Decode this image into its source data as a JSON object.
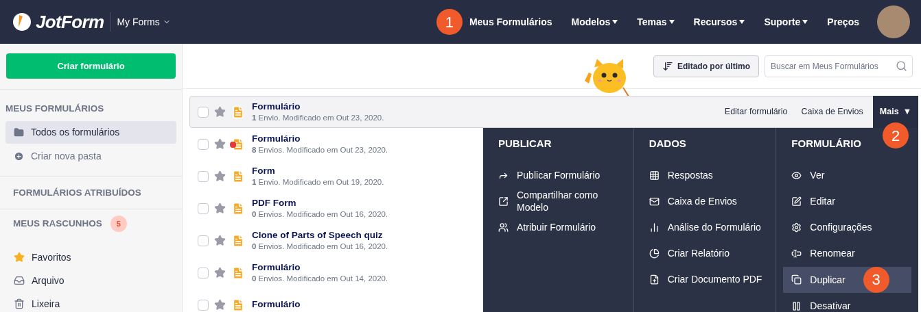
{
  "header": {
    "logo": "JotForm",
    "workspace": "My Forms",
    "nav": [
      {
        "label": "Meus Formulários",
        "has_menu": false,
        "step": "1"
      },
      {
        "label": "Modelos",
        "has_menu": true
      },
      {
        "label": "Temas",
        "has_menu": true
      },
      {
        "label": "Recursos",
        "has_menu": true
      },
      {
        "label": "Suporte",
        "has_menu": true
      },
      {
        "label": "Preços",
        "has_menu": false
      }
    ]
  },
  "sidebar": {
    "create_button": "Criar formulário",
    "my_forms": {
      "title": "MEUS FORMULÁRIOS",
      "items": [
        {
          "label": "Todos os formulários",
          "selected": true
        },
        {
          "label": "Criar nova pasta",
          "selected": false
        }
      ]
    },
    "assigned": {
      "title": "FORMULÁRIOS ATRIBUÍDOS"
    },
    "drafts": {
      "title": "MEUS RASCUNHOS",
      "count": "5"
    },
    "items": [
      {
        "label": "Favoritos",
        "selected": false
      },
      {
        "label": "Arquivo",
        "selected": false
      },
      {
        "label": "Lixeira",
        "selected": false
      }
    ]
  },
  "toolbar": {
    "sort_button": "Editado por último",
    "search": {
      "placeholder": "Buscar em Meus Formulários"
    }
  },
  "forms": [
    {
      "title": "Formulário",
      "count": "1",
      "details": " Envio. Modificado em Out 23, 2020.",
      "selected": true,
      "badge": false
    },
    {
      "title": "Formulário",
      "count": "8",
      "details": " Envios. Modificado em Out 23, 2020.",
      "selected": false,
      "badge": true
    },
    {
      "title": "Form",
      "count": "1",
      "details": " Envio. Modificado em Out 19, 2020.",
      "selected": false,
      "badge": false
    },
    {
      "title": "PDF Form",
      "count": "0",
      "details": " Envios. Modificado em Out 16, 2020.",
      "selected": false,
      "badge": false
    },
    {
      "title": "Clone of Parts of Speech quiz",
      "count": "0",
      "details": " Envios. Modificado em Out 16, 2020.",
      "selected": false,
      "badge": false
    },
    {
      "title": "Formulário",
      "count": "0",
      "details": " Envios. Modificado em Out 14, 2020.",
      "selected": false,
      "badge": false
    },
    {
      "title": "Formulário",
      "selected": false,
      "badge": false
    }
  ],
  "row_actions": {
    "edit": "Editar formulário",
    "inbox": "Caixa de Envios",
    "more": "Mais",
    "more_caret": "▼",
    "step": "2"
  },
  "more_menu": {
    "columns": [
      {
        "title": "PUBLICAR",
        "items": [
          {
            "label": "Publicar Formulário",
            "selected": false
          },
          {
            "label": "Compartilhar como Modelo",
            "selected": false
          },
          {
            "label": "Atribuir Formulário",
            "selected": false
          }
        ]
      },
      {
        "title": "DADOS",
        "items": [
          {
            "label": "Respostas",
            "selected": false
          },
          {
            "label": "Caixa de Envios",
            "selected": false
          },
          {
            "label": "Análise do Formulário",
            "selected": false
          },
          {
            "label": "Criar Relatório",
            "selected": false
          },
          {
            "label": "Criar Documento PDF",
            "selected": false
          }
        ]
      },
      {
        "title": "FORMULÁRIO",
        "items": [
          {
            "label": "Ver",
            "selected": false
          },
          {
            "label": "Editar",
            "selected": false
          },
          {
            "label": "Configurações",
            "selected": false
          },
          {
            "label": "Renomear",
            "selected": false
          },
          {
            "label": "Duplicar",
            "selected": true,
            "step": "3"
          },
          {
            "label": "Desativar",
            "selected": false
          }
        ]
      }
    ]
  }
}
